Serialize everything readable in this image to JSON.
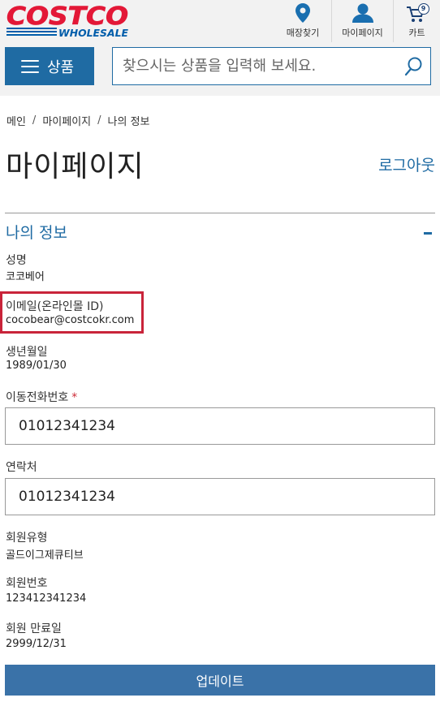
{
  "header": {
    "logo_top": "COSTCO",
    "logo_bottom": "WHOLESALE",
    "nav": {
      "store_label": "매장찾기",
      "mypage_label": "마이페이지",
      "cart_label": "카트",
      "cart_count": "9"
    },
    "menu_label": "상품",
    "search": {
      "placeholder": "찾으시는 상품을 입력해 보세요."
    },
    "colors": {
      "logo_red": "#e31837",
      "logo_blue": "#005daa",
      "accent": "#1f6ba3",
      "nav_icon": "#1a6fb0"
    }
  },
  "breadcrumb": [
    "메인",
    "마이페이지",
    "나의 정보"
  ],
  "page": {
    "title": "마이페이지",
    "logout": "로그아웃",
    "section_title": "나의 정보"
  },
  "fields": {
    "name": {
      "label": "성명",
      "value": "코코베어"
    },
    "email": {
      "label": "이메일(온라인몰 ID)",
      "value": "cocobear@costcokr.com"
    },
    "birth": {
      "label": "생년월일",
      "value": "1989/01/30"
    },
    "mobile": {
      "label": "이동전화번호",
      "required": "*",
      "value": "01012341234"
    },
    "contact": {
      "label": "연락처",
      "value": "01012341234"
    },
    "member_type": {
      "label": "회원유형",
      "value": "골드이그제큐티브"
    },
    "member_no": {
      "label": "회원번호",
      "value": "123412341234"
    },
    "expiry": {
      "label": "회원 만료일",
      "value": "2999/12/31"
    }
  },
  "update_button": "업데이트",
  "highlight_color": "#c9243a"
}
